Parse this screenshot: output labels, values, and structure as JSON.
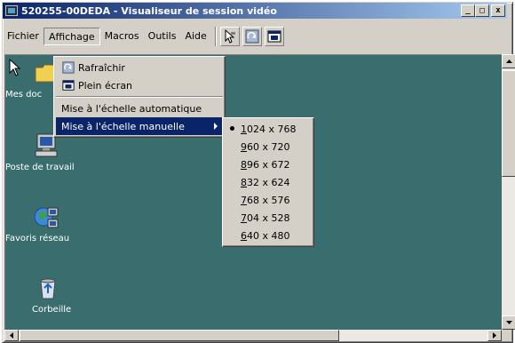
{
  "window": {
    "title": "520255-00DEDA - Visualiseur de session vidéo",
    "buttons": {
      "minimize": "_",
      "maximize": "□",
      "close": "x"
    }
  },
  "menubar": {
    "items": [
      {
        "label": "Fichier"
      },
      {
        "label": "Affichage"
      },
      {
        "label": "Macros"
      },
      {
        "label": "Outils"
      },
      {
        "label": "Aide"
      }
    ]
  },
  "affichage_menu": {
    "refresh": "Rafraîchir",
    "fullscreen": "Plein écran",
    "auto_scale": "Mise à l'échelle automatique",
    "manual_scale": "Mise à l'échelle manuelle"
  },
  "scale_submenu": {
    "options": [
      {
        "first": "1",
        "rest": "024 x 768",
        "selected": true
      },
      {
        "first": "9",
        "rest": "60 x 720"
      },
      {
        "first": "8",
        "rest": "96 x 672"
      },
      {
        "first": "8",
        "rest": "32 x 624"
      },
      {
        "first": "7",
        "rest": "68 x 576"
      },
      {
        "first": "7",
        "rest": "04 x 528"
      },
      {
        "first": "6",
        "rest": "40 x 480"
      }
    ]
  },
  "desktop": {
    "icons": [
      {
        "label": "Mes doc"
      },
      {
        "label": "Poste de travail"
      },
      {
        "label": "Favoris réseau"
      },
      {
        "label": "Corbeille"
      }
    ]
  },
  "colors": {
    "desktop": "#3a6e6e",
    "highlight": "#0a246a",
    "chrome": "#d4d0c8"
  }
}
